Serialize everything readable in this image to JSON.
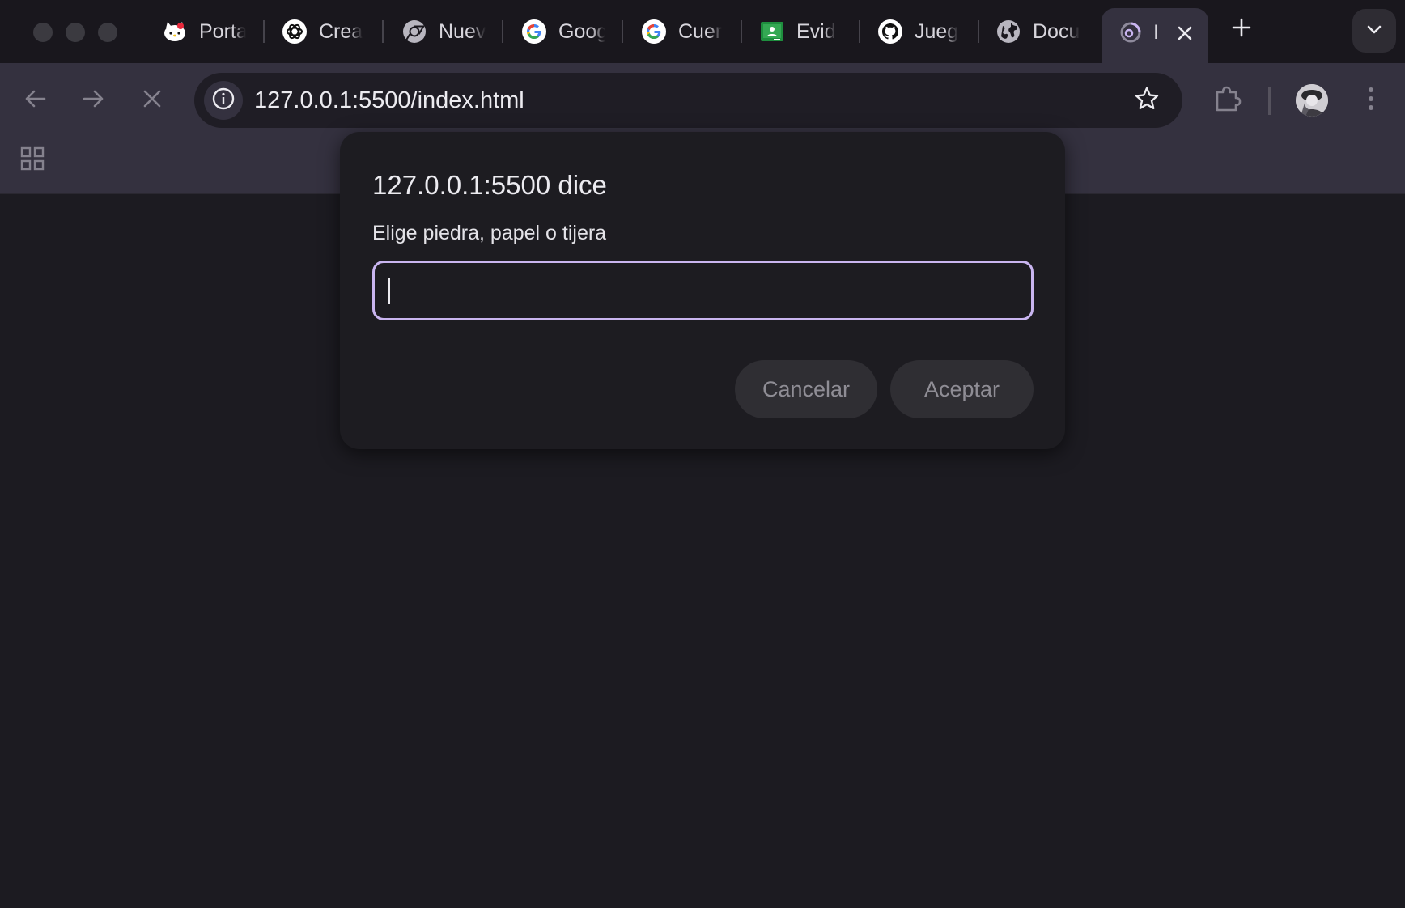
{
  "browser": {
    "tabs": [
      {
        "label": "Porta",
        "icon": "hello-kitty-icon"
      },
      {
        "label": "Crea",
        "icon": "openai-icon"
      },
      {
        "label": "Nuev",
        "icon": "chrome-icon"
      },
      {
        "label": "Goog",
        "icon": "google-icon"
      },
      {
        "label": "Cuer",
        "icon": "google-icon"
      },
      {
        "label": "Evid",
        "icon": "classroom-icon"
      },
      {
        "label": "Jueg",
        "icon": "github-icon"
      },
      {
        "label": "Docu",
        "icon": "globe-icon"
      },
      {
        "label": "I",
        "icon": "loading-spinner-icon",
        "active": true
      }
    ],
    "address": {
      "url": "127.0.0.1:5500/index.html"
    }
  },
  "dialog": {
    "title": "127.0.0.1:5500 dice",
    "message": "Elige piedra, papel o tijera",
    "input_value": "",
    "cancel_label": "Cancelar",
    "accept_label": "Aceptar"
  },
  "colors": {
    "tabstrip_bg": "#19171d",
    "toolbar_bg": "#34313f",
    "page_bg": "#1c1b21",
    "input_focus_border": "#c9b5f0"
  }
}
